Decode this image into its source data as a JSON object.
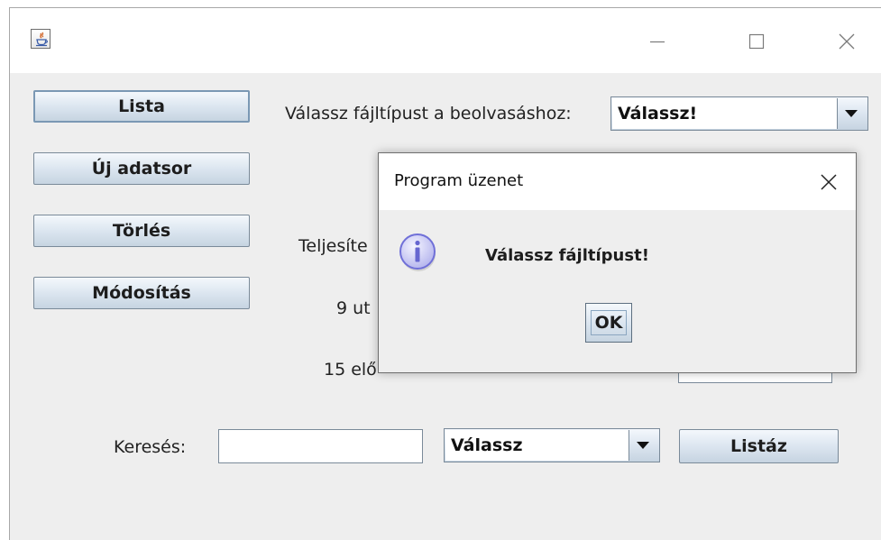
{
  "window": {
    "title": "",
    "controls": {
      "minimize": "minimize-icon",
      "maximize": "maximize-icon",
      "close": "close-icon"
    }
  },
  "sidebar": {
    "buttons": [
      {
        "label": "Lista"
      },
      {
        "label": "Új adatsor"
      },
      {
        "label": "Törlés"
      },
      {
        "label": "Módosítás"
      }
    ]
  },
  "filetype": {
    "label": "Válassz fájltípust a beolvasáshoz:",
    "selected": "Válassz!"
  },
  "info": {
    "line1": "Teljesíte",
    "line2": "9 ut",
    "line3": "15 elő"
  },
  "search": {
    "label": "Keresés:",
    "value": "",
    "combo_selected": "Válassz",
    "list_button": "Listáz"
  },
  "dialog": {
    "title": "Program üzenet",
    "message": "Válassz fájltípust!",
    "ok_label": "OK",
    "icon": "info-icon"
  },
  "colors": {
    "button_gradient_top": "#f4f8fc",
    "button_gradient_bottom": "#c6d4e1",
    "info_icon": "#8080e0"
  }
}
